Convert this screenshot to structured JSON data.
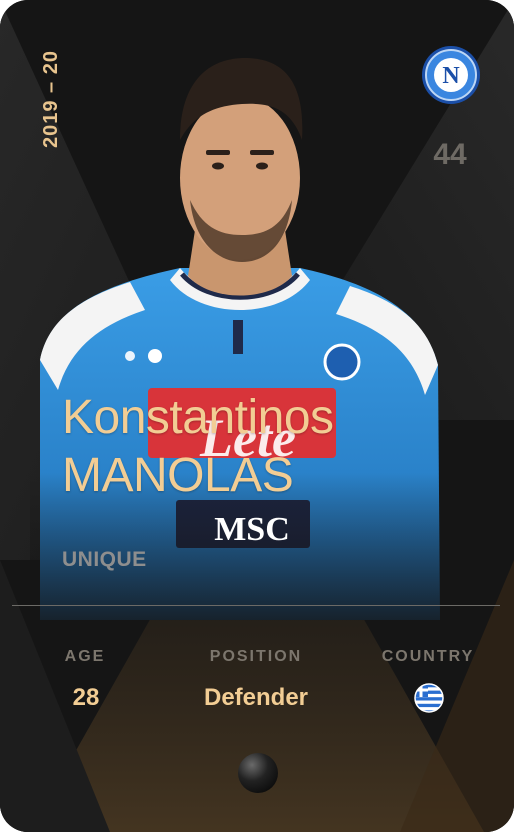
{
  "card": {
    "season": "2019 – 20",
    "shirt_number": "44",
    "first_name": "Konstantinos",
    "last_name": "MANOLAS",
    "rarity": "UNIQUE",
    "club": {
      "logo_letter": "N"
    },
    "sponsor": "MSC",
    "shirt_brand_text": "Lete"
  },
  "stats": [
    {
      "label": "AGE",
      "value": "28"
    },
    {
      "label": "POSITION",
      "value": "Defender"
    },
    {
      "label": "COUNTRY",
      "flag": "greece-flag-icon"
    }
  ],
  "colors": {
    "gold": "#f2cd94",
    "card_bg": "#141414",
    "napoli_blue": "#2f8fd8"
  }
}
